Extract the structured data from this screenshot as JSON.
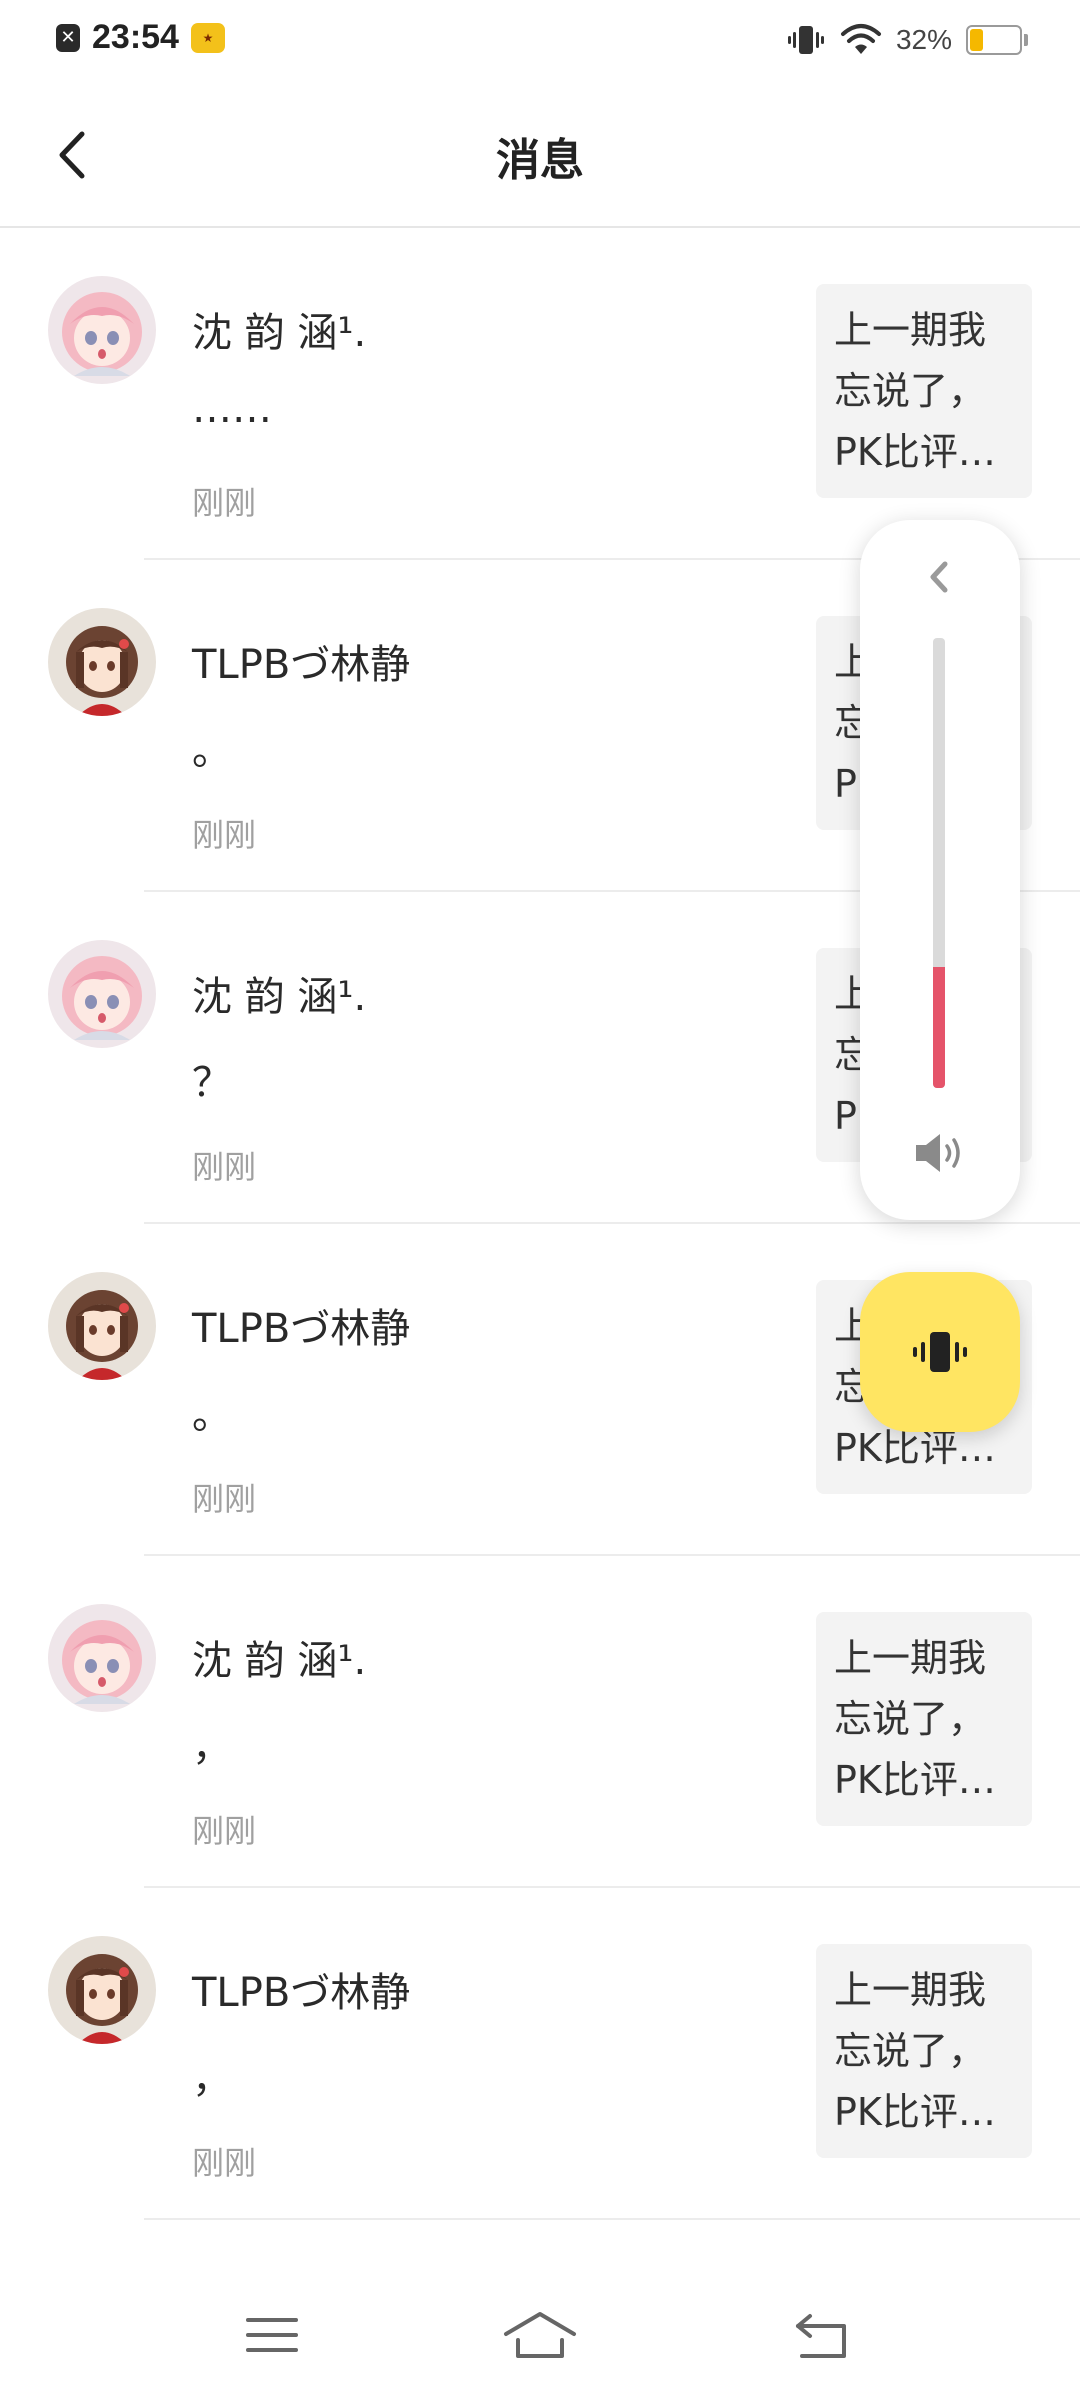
{
  "status_bar": {
    "time": "23:54",
    "battery_text": "32%",
    "battery_level": 0.32,
    "battery_color": "#f5b800",
    "icons": [
      "notification-close-icon",
      "app-icon",
      "vibrate-icon",
      "wifi-icon",
      "battery-icon"
    ]
  },
  "header": {
    "title": "消息",
    "back_icon": "back-arrow-icon"
  },
  "messages": [
    {
      "name": "沈 韵 涵¹.",
      "text": "……",
      "time": "刚刚",
      "avatar": "pink-hair-girl",
      "preview": [
        "上一期我",
        "忘说了，",
        "PK比评…"
      ]
    },
    {
      "name": "TLPBづ林静",
      "text": "。",
      "time": "刚刚",
      "avatar": "brown-hair-girl",
      "preview": [
        "上一期我",
        "忘说了，",
        "PK比评…"
      ]
    },
    {
      "name": "沈 韵 涵¹.",
      "text": "？",
      "time": "刚刚",
      "avatar": "pink-hair-girl",
      "preview": [
        "上一期我",
        "忘说了，",
        "PK比评…"
      ]
    },
    {
      "name": "TLPBづ林静",
      "text": "。",
      "time": "刚刚",
      "avatar": "brown-hair-girl",
      "preview": [
        "上一期我",
        "忘说了，",
        "PK比评…"
      ]
    },
    {
      "name": "沈 韵 涵¹.",
      "text": "，",
      "time": "刚刚",
      "avatar": "pink-hair-girl",
      "preview": [
        "上一期我",
        "忘说了，",
        "PK比评…"
      ]
    },
    {
      "name": "TLPBづ林静",
      "text": "，",
      "time": "刚刚",
      "avatar": "brown-hair-girl",
      "preview": [
        "上一期我",
        "忘说了，",
        "PK比评…"
      ]
    }
  ],
  "volume_overlay": {
    "level": 0.27,
    "fill_color": "#e5546a",
    "ring_mode": "vibrate",
    "ring_button_color": "#ffe562"
  },
  "nav_bar": {
    "buttons": [
      "menu-icon",
      "home-icon",
      "back-icon"
    ]
  }
}
